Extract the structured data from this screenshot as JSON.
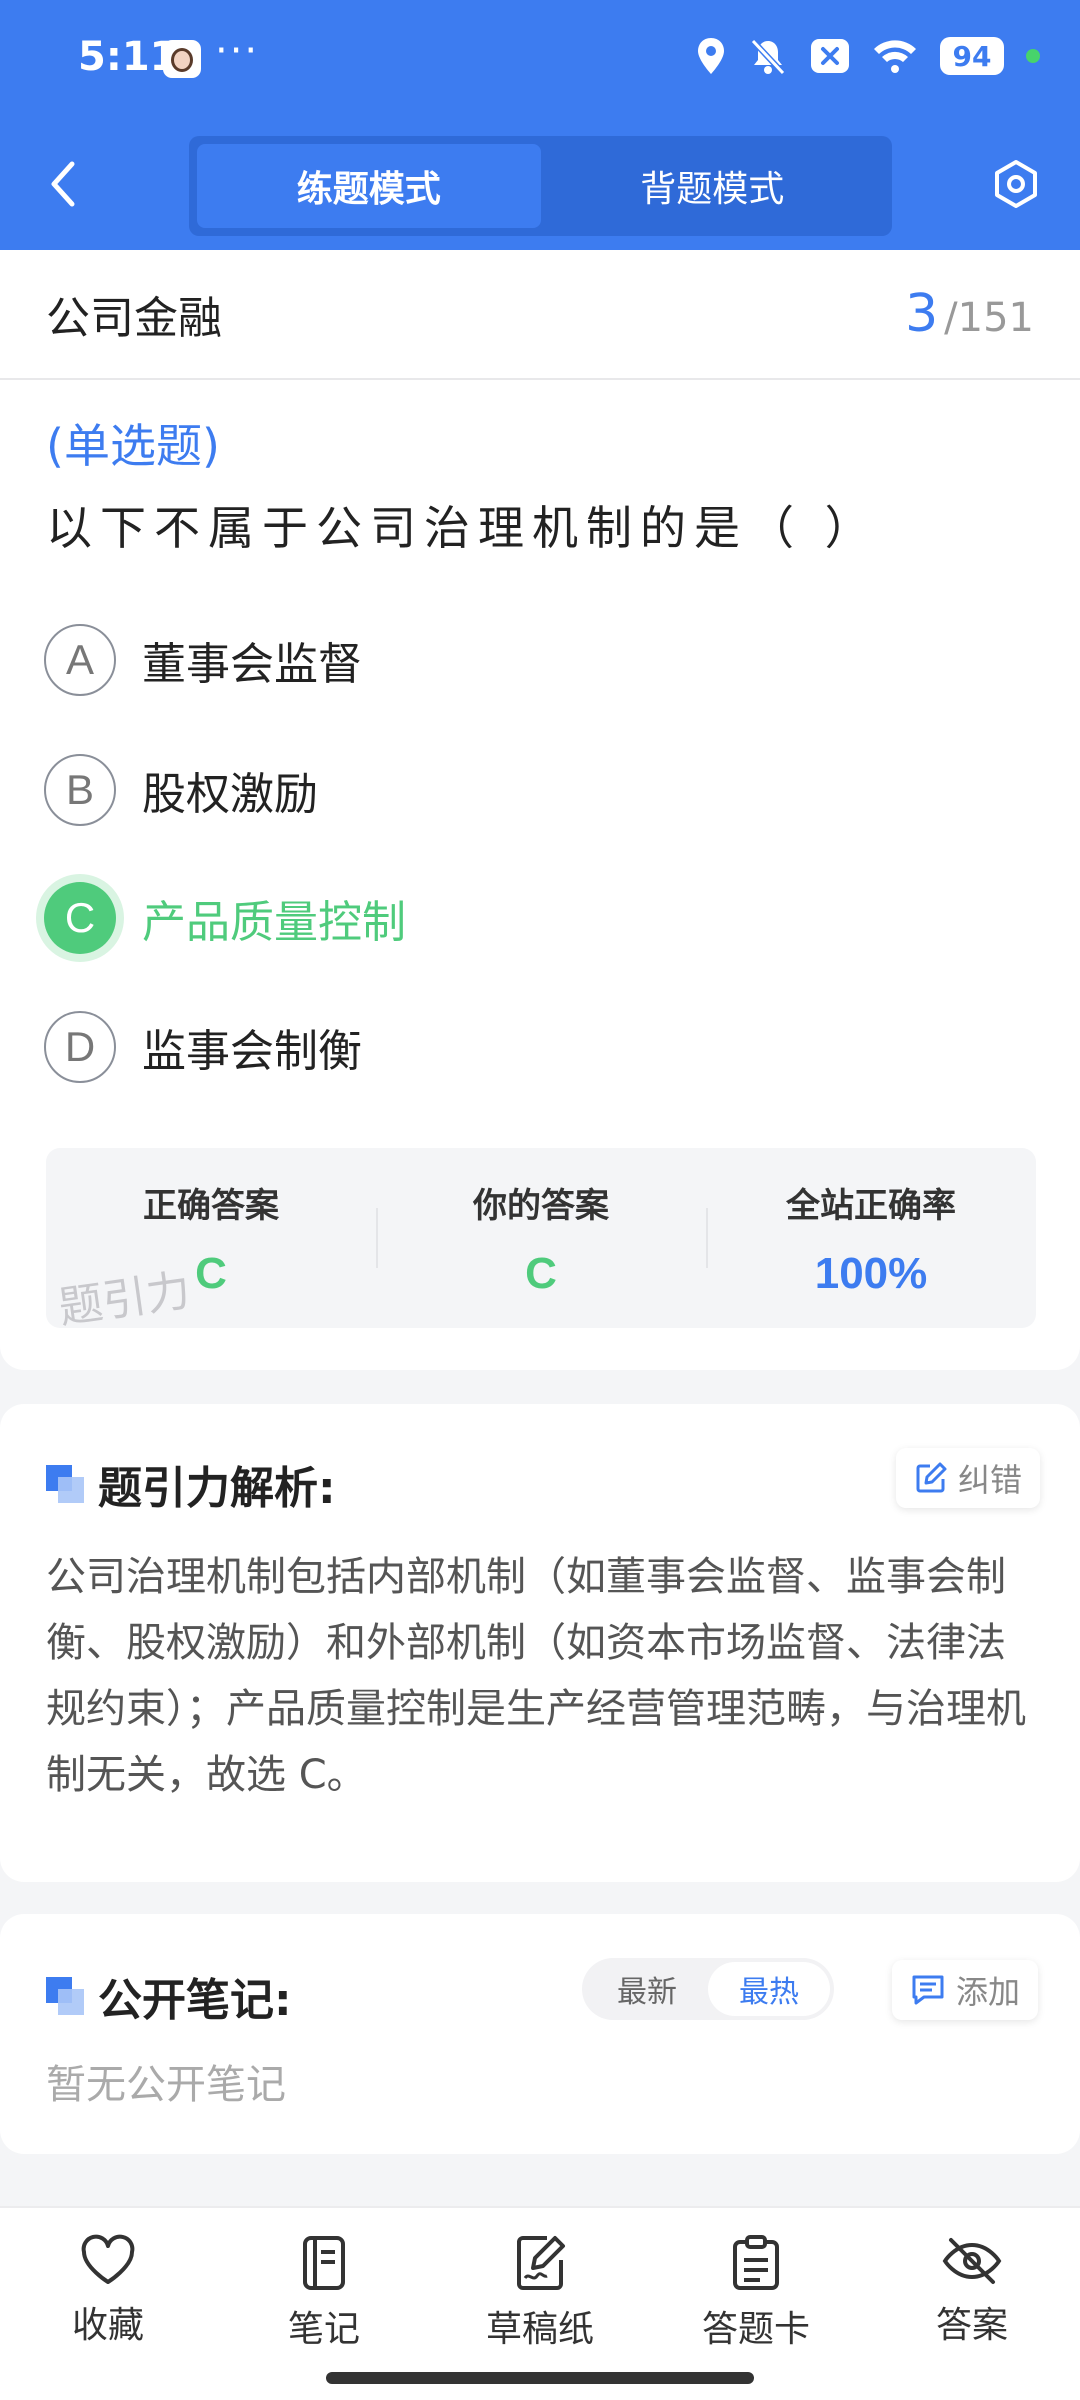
{
  "status_bar": {
    "time": "5:11",
    "more": "···",
    "battery": "94"
  },
  "header": {
    "tabs": [
      {
        "label": "练题模式",
        "active": true
      },
      {
        "label": "背题模式",
        "active": false
      }
    ],
    "accent_color": "#3d7cf0"
  },
  "question_header": {
    "subject": "公司金融",
    "current": "3",
    "separator": "/",
    "total": "151"
  },
  "question": {
    "type_label": "(单选题)",
    "text": "以下不属于公司治理机制的是（  ）",
    "options": [
      {
        "letter": "A",
        "text": "董事会监督",
        "state": "normal"
      },
      {
        "letter": "B",
        "text": "股权激励",
        "state": "normal"
      },
      {
        "letter": "C",
        "text": "产品质量控制",
        "state": "correct"
      },
      {
        "letter": "D",
        "text": "监事会制衡",
        "state": "normal"
      }
    ],
    "correct_color": "#4fcb7c"
  },
  "summary": {
    "correct_label": "正确答案",
    "correct_value": "C",
    "yours_label": "你的答案",
    "yours_value": "C",
    "rate_label": "全站正确率",
    "rate_value": "100%",
    "watermark": "题引力"
  },
  "analysis": {
    "title": "题引力解析:",
    "report_label": "纠错",
    "text": "公司治理机制包括内部机制（如董事会监督、监事会制衡、股权激励）和外部机制（如资本市场监督、法律法规约束）；产品质量控制是生产经营管理范畴，与治理机制无关，故选 C。"
  },
  "notes": {
    "title": "公开笔记:",
    "sort_options": [
      {
        "label": "最新",
        "active": false
      },
      {
        "label": "最热",
        "active": true
      }
    ],
    "add_label": "添加",
    "empty_text": "暂无公开笔记"
  },
  "bottom_nav": [
    {
      "label": "收藏",
      "icon": "heart-icon"
    },
    {
      "label": "笔记",
      "icon": "notebook-icon"
    },
    {
      "label": "草稿纸",
      "icon": "draft-icon"
    },
    {
      "label": "答题卡",
      "icon": "clipboard-icon"
    },
    {
      "label": "答案",
      "icon": "eye-off-icon"
    }
  ]
}
